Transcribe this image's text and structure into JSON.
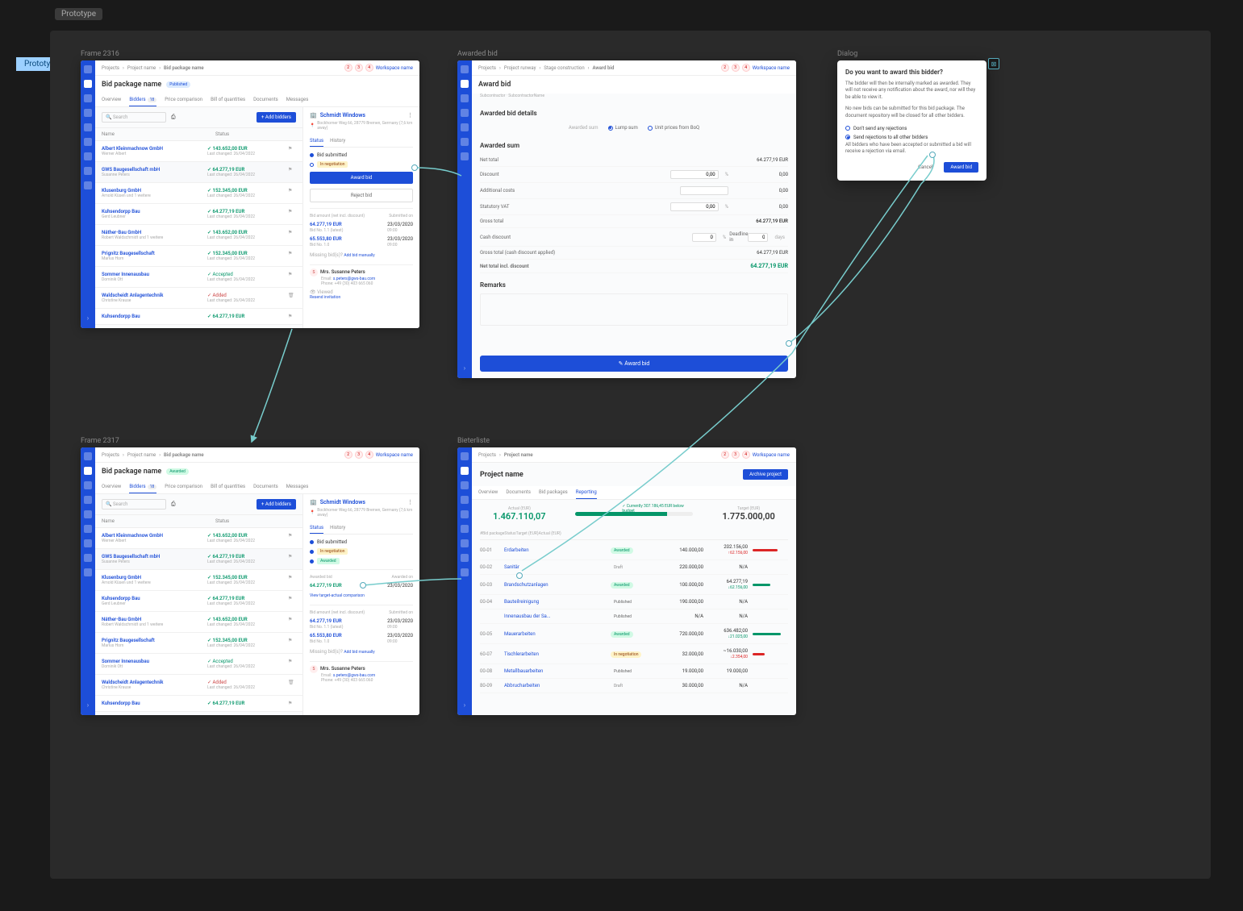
{
  "prototype": {
    "tag": "Prototype",
    "badge": "Prototype"
  },
  "frames": {
    "f2316": {
      "label": "Frame 2316"
    },
    "awarded": {
      "label": "Awarded bid"
    },
    "dialog": {
      "label": "Dialog"
    },
    "f2317": {
      "label": "Frame 2317"
    },
    "bieter": {
      "label": "Bieterliste"
    }
  },
  "breadcrumbs": {
    "p1": "Projects",
    "p2": "Project name",
    "p3": "Bid package name",
    "p2b": "Project runway",
    "p3b": "Stage construction",
    "p4b": "Award bid"
  },
  "workspace": "Workspace name",
  "bidpkg": {
    "title": "Bid package name",
    "status_pub": "Published",
    "status_award": "Awarded",
    "tabs": {
      "overview": "Overview",
      "bidders": "Bidders",
      "bidders_count": "18",
      "price": "Price comparison",
      "boq": "Bill of quantities",
      "docs": "Documents",
      "msgs": "Messages"
    },
    "search_ph": "Search",
    "add_btn": "+ Add bidders",
    "col_name": "Name",
    "col_status": "Status"
  },
  "bidders": [
    {
      "name": "Albert Kleinmachnow GmbH",
      "sub": "Werner Albert",
      "amt": "143.652,00 EUR",
      "date": "Last changed: 26/04/2022"
    },
    {
      "name": "GWS Baugesellschaft mbH",
      "sub": "Susanne Peters",
      "amt": "64.277,19 EUR",
      "date": "Last changed: 26/04/2022",
      "sel": true
    },
    {
      "name": "Klusenburg GmbH",
      "sub": "Arnold Küsen und 1 weitere",
      "amt": "152.345,00 EUR",
      "date": "Last changed: 26/04/2022"
    },
    {
      "name": "Kuhsendorpp Bau",
      "sub": "Gerd Leubner",
      "amt": "64.277,19 EUR",
      "date": "Last changed: 26/04/2022"
    },
    {
      "name": "Näther-Bau GmbH",
      "sub": "Robert Waldschmidt und 1 weitere",
      "amt": "143.652,00 EUR",
      "date": "Last changed: 26/04/2022"
    },
    {
      "name": "Prignitz Baugesellschaft",
      "sub": "Marius Horn",
      "amt": "152.345,00 EUR",
      "date": "Last changed: 26/04/2022"
    },
    {
      "name": "Sommer Innenausbau",
      "sub": "Dominik Ott",
      "status": "Accepted",
      "date": "Last changed: 26/04/2022"
    },
    {
      "name": "Waldscheidt Anlagentechnik",
      "sub": "Christine Krause",
      "status": "Added",
      "date": "Last changed: 26/04/2022",
      "del": true
    },
    {
      "name": "Kuhsendorpp Bau",
      "sub": "",
      "amt": "64.277,19 EUR",
      "date": ""
    }
  ],
  "detail": {
    "company": "Schmidt Windows",
    "addr": "Bockhorner Weg 66, 28779 Bremen, Germany (7,6 km away)",
    "tabs": {
      "status": "Status",
      "history": "History"
    },
    "bid_sub": "Bid submitted",
    "neg": "In negotiation",
    "awarded": "Awarded",
    "award_btn": "Award bid",
    "reject_btn": "Reject bid",
    "bid_head1": "Bid amount (net incl. discount)",
    "bid_head2": "Submitted on",
    "bids": [
      {
        "amt": "64.277,19 EUR",
        "no": "Bid No. 1.1 (latest)",
        "date": "23/03/2020",
        "time": "09:00"
      },
      {
        "amt": "65.553,80 EUR",
        "no": "Bid No. 1.0",
        "date": "23/03/2020",
        "time": "09:00"
      }
    ],
    "missing": "Missing bid(s)?",
    "add_manual": "Add bid manually",
    "awarded_bid_lbl": "Awarded bid",
    "awarded_amt": "64.277,19 EUR",
    "awarded_on_lbl": "Awarded on",
    "awarded_on": "23/03/2020",
    "view_link": "View target-actual comparison",
    "contact": {
      "name": "Mrs. Susanne Peters",
      "email_lbl": "Email:",
      "email": "s.peters@gws-bau.com",
      "phone_lbl": "Phone:",
      "phone": "+49 (30) 403 665 060",
      "viewed": "Viewed",
      "resend": "Resend invitation"
    }
  },
  "awardscreen": {
    "title": "Award bid",
    "sub": "Subcontractor · SubcontractorName",
    "h_details": "Awarded bid details",
    "h_sum": "Awarded sum",
    "h_remarks": "Remarks",
    "awsum_lbl": "Awarded sum",
    "opt_lump": "Lump sum",
    "opt_unit": "Unit prices from BoQ",
    "rows": {
      "net": "Net total",
      "net_v": "64.277,19 EUR",
      "disc": "Discount",
      "disc_v": "0,00",
      "disc_pct": "0,00",
      "add": "Additional costs",
      "add_v": "0,00",
      "vat": "Statutory VAT",
      "vat_pct": "0,00",
      "vat_v": "0,00",
      "gross": "Gross total",
      "gross_v": "64.277,19 EUR",
      "cash": "Cash discount",
      "cash_pct": "0",
      "deadline": "Deadline in",
      "days_v": "0",
      "days": "days",
      "grossc": "Gross total (cash discount applied)",
      "grossc_v": "64.277,19 EUR",
      "final": "Net total incl. discount",
      "final_v": "64.277,19 EUR"
    },
    "btn": "Award bid"
  },
  "dialog": {
    "title": "Do you want to award this bidder?",
    "p1": "The bidder will then be internally marked as awarded. They will not receive any notification about the award, nor will they be able to view it.",
    "p2": "No new bids can be submitted for this bid package. The document repository will be closed for all other bidders.",
    "opt1": "Don't send any rejections",
    "opt2": "Send rejections to all other bidders",
    "p3": "All bidders who have been accepted or submitted a bid will receive a rejection via email.",
    "cancel": "Cancel",
    "award": "Award bid"
  },
  "report": {
    "breadcrumb": {
      "p1": "Projects",
      "p2": "Project name"
    },
    "title": "Project name",
    "archive": "Archive project",
    "tabs": {
      "over": "Overview",
      "docs": "Documents",
      "bp": "Bid packages",
      "rep": "Reporting"
    },
    "actual_lbl": "Actual (EUR)",
    "actual": "1.467.110,07",
    "prog": "Currently 307.186,45 EUR below budget",
    "target_lbl": "Target (EUR)",
    "target": "1.775.000,00",
    "cols": {
      "id": "#",
      "bp": "Bid package",
      "st": "Status",
      "tgt": "Target (EUR)",
      "act": "Actual (EUR)"
    },
    "rows": [
      {
        "id": "00-01",
        "bp": "Erdarbeiten",
        "st": "Awarded",
        "stc": "aw",
        "tgt": "140.000,00",
        "act": "202.156,00",
        "d": "↑62.156,00",
        "dc": "neg",
        "bar": "r",
        "bw": "70%"
      },
      {
        "id": "00-02",
        "bp": "Sanitär",
        "st": "Draft",
        "stc": "dr",
        "tgt": "220.000,00",
        "act": "N/A"
      },
      {
        "id": "00-03",
        "bp": "Brandschutzanlagen",
        "st": "Awarded",
        "stc": "aw",
        "tgt": "100.000,00",
        "act": "64.277,19",
        "d": "↓62.156,00",
        "dc": "pos",
        "bar": "g",
        "bw": "50%"
      },
      {
        "id": "00-04",
        "bp": "Bauteilreinigung",
        "st": "Published",
        "stc": "pb",
        "tgt": "190.000,00",
        "act": "N/A"
      },
      {
        "id": "",
        "bp": "Innenausbau der Sa...",
        "st": "Published",
        "stc": "pb",
        "tgt": "N/A",
        "act": "N/A"
      },
      {
        "id": "00-05",
        "bp": "Mauerarbeiten",
        "st": "Awarded",
        "stc": "aw",
        "tgt": "720.000,00",
        "act": "636.482,00",
        "d": "↓21.025,00",
        "dc": "pos",
        "bar": "g",
        "bw": "80%"
      },
      {
        "id": "60-07",
        "bp": "Tischlerarbeiten",
        "st": "In negotiation",
        "stc": "ng",
        "tgt": "32.000,00",
        "act": "~16.030,00",
        "d": "↓2.354,00",
        "dc": "neg",
        "bar": "r",
        "bw": "35%"
      },
      {
        "id": "00-08",
        "bp": "Metallbauarbeiten",
        "st": "Published",
        "stc": "pb",
        "tgt": "19.000,00",
        "act": "19.000,00",
        "d": "",
        "dc": ""
      },
      {
        "id": "80-09",
        "bp": "Abbrucharbeiten",
        "st": "Draft",
        "stc": "dr",
        "tgt": "30.000,00",
        "act": "N/A"
      }
    ]
  }
}
